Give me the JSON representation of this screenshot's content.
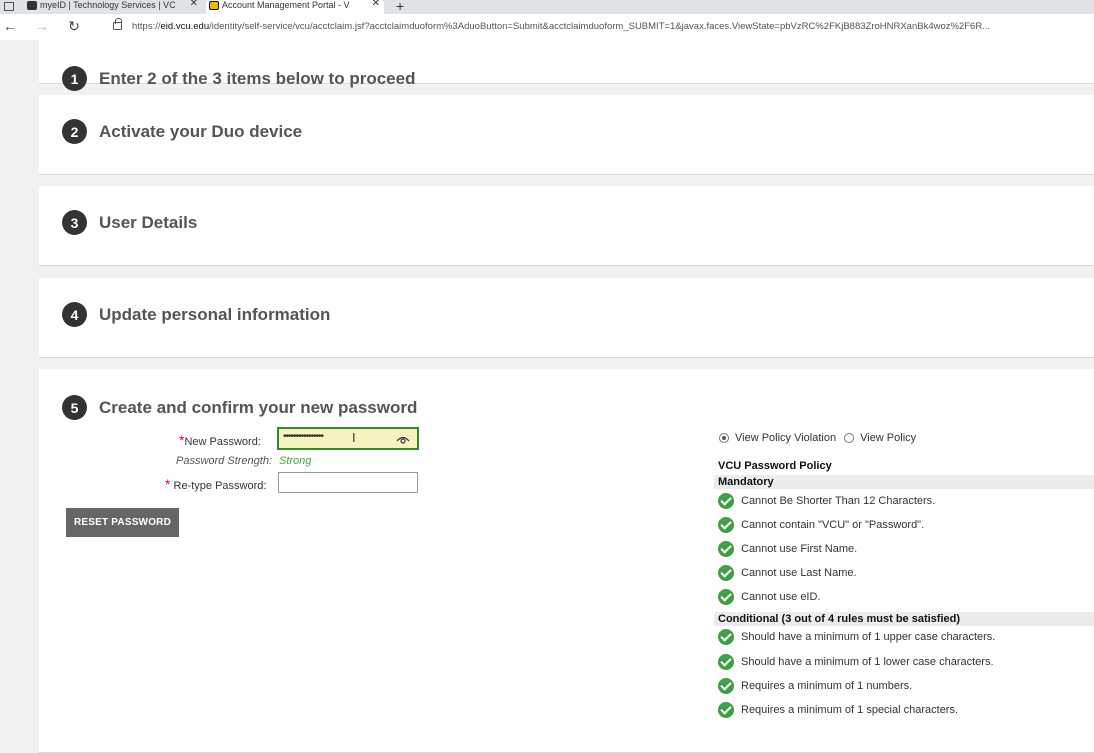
{
  "browser": {
    "tabs": [
      {
        "label": "myeID | Technology Services | VC",
        "close": "✕"
      },
      {
        "label": "Account Management Portal - V",
        "close": "✕"
      }
    ],
    "new_tab": "+",
    "url_domain": "eid.vcu.edu",
    "url_prefix": "https://",
    "url_rest": "/identity/self-service/vcu/acctclaim.jsf?acctclaimduoform%3AduoButton=Submit&acctclaimduoform_SUBMIT=1&javax.faces.ViewState=pbVzRC%2FKjB883ZroHNRXanBk4woz%2F6R..."
  },
  "steps": [
    {
      "num": "1",
      "title": "Enter 2 of the 3 items below to proceed"
    },
    {
      "num": "2",
      "title": "Activate your Duo device"
    },
    {
      "num": "3",
      "title": "User Details"
    },
    {
      "num": "4",
      "title": "Update personal information"
    },
    {
      "num": "5",
      "title": "Create and confirm your new password"
    }
  ],
  "form": {
    "required_mark": "*",
    "new_password_label": "New Password:",
    "new_password_value": "••••••••••••••••",
    "strength_label": "Password Strength:",
    "strength_value": "Strong",
    "retype_label": "Re-type Password:",
    "retype_value": "",
    "reset_button": "RESET PASSWORD"
  },
  "policy": {
    "view_violation": "View Policy Violation",
    "view_policy": "View Policy",
    "selected": "violation",
    "title": "VCU Password Policy",
    "mandatory_label": "Mandatory",
    "mandatory_rules": [
      "Cannot Be Shorter Than 12 Characters.",
      "Cannot contain \"VCU\" or \"Password\".",
      "Cannot use First Name.",
      "Cannot use Last Name.",
      "Cannot use eID."
    ],
    "conditional_label": "Conditional (3 out of 4 rules must be satisfied)",
    "conditional_rules": [
      "Should have a minimum of 1 upper case characters.",
      "Should have a minimum of 1 lower case characters.",
      "Requires a minimum of 1 numbers.",
      "Requires a minimum of 1 special characters."
    ]
  },
  "colors": {
    "check": "#41a047",
    "strong": "#3aa83a",
    "required": "#c8102e",
    "button": "#666666"
  }
}
